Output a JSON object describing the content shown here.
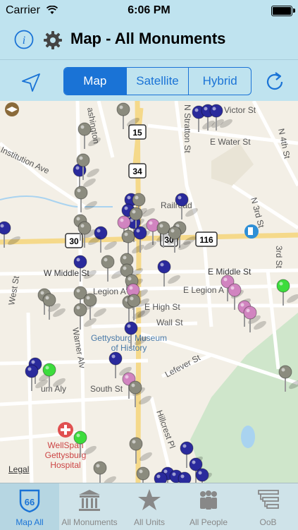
{
  "status": {
    "carrier": "Carrier",
    "time": "6:06 PM"
  },
  "header": {
    "title": "Map - All Monuments"
  },
  "icons": {
    "info": "info-icon",
    "settings": "gear-icon",
    "locate": "location-arrow-icon",
    "refresh": "refresh-icon"
  },
  "segments": {
    "map": "Map",
    "satellite": "Satellite",
    "hybrid": "Hybrid",
    "selected": "Map"
  },
  "map": {
    "labels": {
      "stratton": "N Stratton St",
      "victor": "Victor St",
      "water": "E Water St",
      "fourth": "N 4th St",
      "institution": "Institution Ave",
      "railroad": "Railroad",
      "third": "N 3rd St",
      "third_b": "3rd St",
      "w_middle": "W Middle St",
      "e_middle": "E Middle St",
      "legion": "Legion A",
      "e_legion": "E Legion A",
      "e_high": "E High St",
      "wall": "Wall St",
      "west": "West St",
      "warner": "Warner Alv",
      "lefever": "Lefever St",
      "south": "South St",
      "hillcrest": "Hillcrest Pl",
      "aly": "um Aly",
      "museum_line1": "Gettysburg Museum",
      "museum_line2": "of History",
      "hospital_line1": "WellSpan",
      "hospital_line2": "Gettysburg",
      "hospital_line3": "Hospital",
      "washington": "ashington",
      "route_15": "15",
      "route_34": "34",
      "route_30_w": "30",
      "route_30_e": "30",
      "route_116": "116",
      "legal": "Legal"
    },
    "pin_colors": {
      "blue": "#2a2a9c",
      "gray": "#8b8b7e",
      "pink": "#d184c0",
      "green": "#3ddc3d"
    }
  },
  "tabs": [
    {
      "label": "Map All",
      "icon": "route-66-shield-icon",
      "active": true
    },
    {
      "label": "All Monuments",
      "icon": "monument-building-icon",
      "active": false
    },
    {
      "label": "All Units",
      "icon": "star-icon",
      "active": false
    },
    {
      "label": "All People",
      "icon": "people-icon",
      "active": false
    },
    {
      "label": "OoB",
      "icon": "order-of-battle-icon",
      "active": false
    }
  ]
}
